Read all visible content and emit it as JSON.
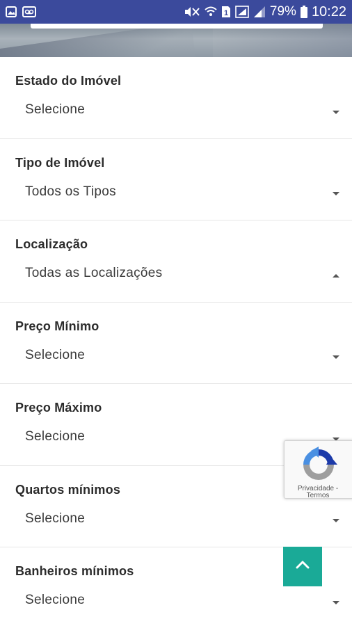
{
  "status_bar": {
    "battery": "79%",
    "time": "10:22",
    "sim_label": "1",
    "icons": [
      "image-icon",
      "voicemail-icon",
      "mute-icon",
      "wifi-icon",
      "sim-icon",
      "signal-icon",
      "battery-icon"
    ]
  },
  "form": {
    "fields": [
      {
        "label": "Estado do Imóvel",
        "value": "Selecione",
        "caret": "down"
      },
      {
        "label": "Tipo de Imóvel",
        "value": "Todos os Tipos",
        "caret": "down"
      },
      {
        "label": "Localização",
        "value": "Todas as Localizações",
        "caret": "up"
      },
      {
        "label": "Preço Mínimo",
        "value": "Selecione",
        "caret": "down"
      },
      {
        "label": "Preço Máximo",
        "value": "Selecione",
        "caret": "down"
      },
      {
        "label": "Quartos mínimos",
        "value": "Selecione",
        "caret": "down"
      },
      {
        "label": "Banheiros mínimos",
        "value": "Selecione",
        "caret": "down"
      }
    ]
  },
  "recaptcha": {
    "privacy": "Privacidade",
    "separator": " - ",
    "terms": "Termos"
  },
  "colors": {
    "status_bar": "#3b4a9c",
    "back_to_top": "#1aaa97"
  }
}
